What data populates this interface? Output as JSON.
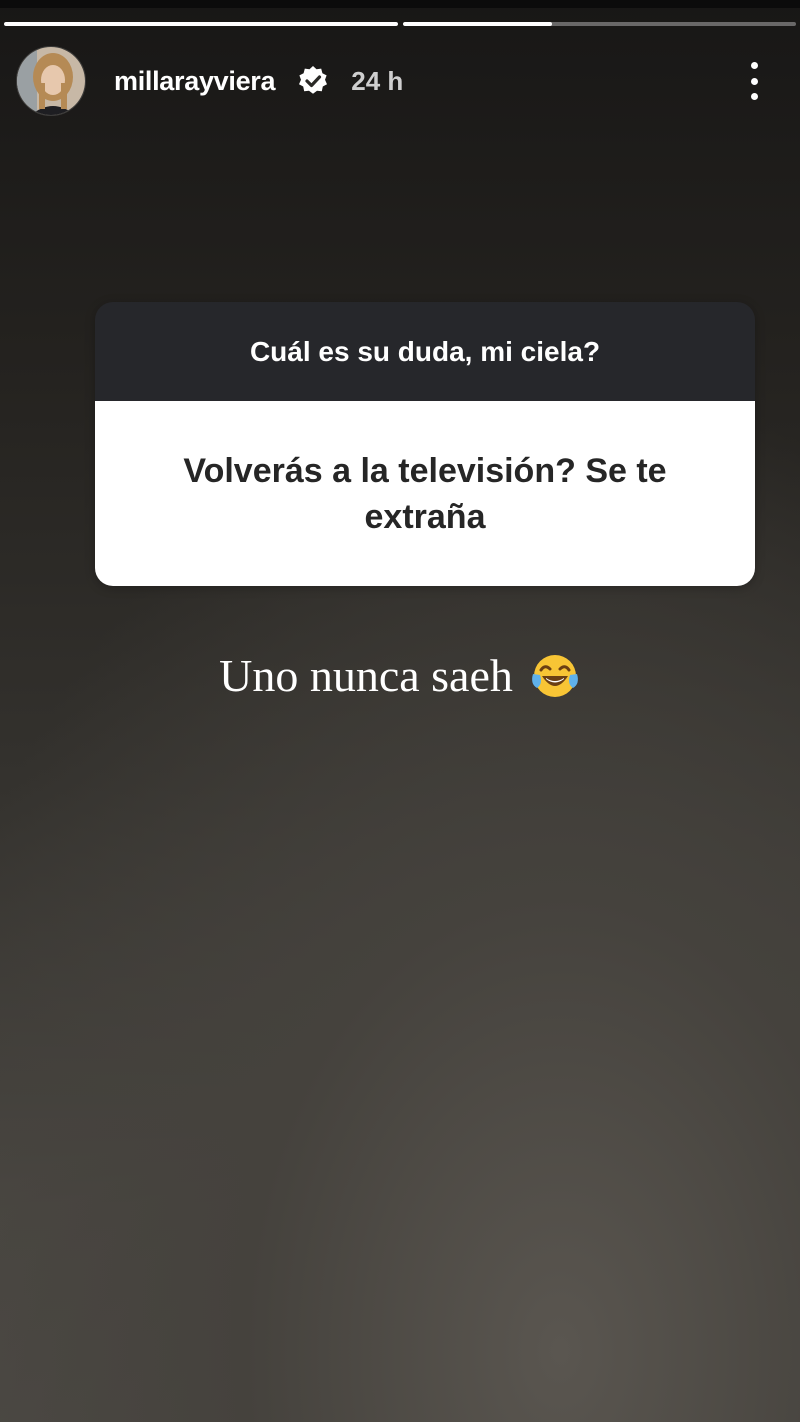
{
  "story": {
    "progress": [
      1.0,
      0.38
    ],
    "user": {
      "username": "millarayviera",
      "verified": true,
      "time": "24 h"
    },
    "question_box": {
      "prompt": "Cuál es su duda, mi ciela?",
      "question": "Volverás a la televisión? Se te extraña"
    },
    "answer": {
      "text": "Uno nunca saeh",
      "emoji": "face-with-tears-of-joy-icon"
    }
  },
  "colors": {
    "question_header": "#26272b",
    "question_body": "#ffffff",
    "verified_badge": "#ffffff"
  }
}
